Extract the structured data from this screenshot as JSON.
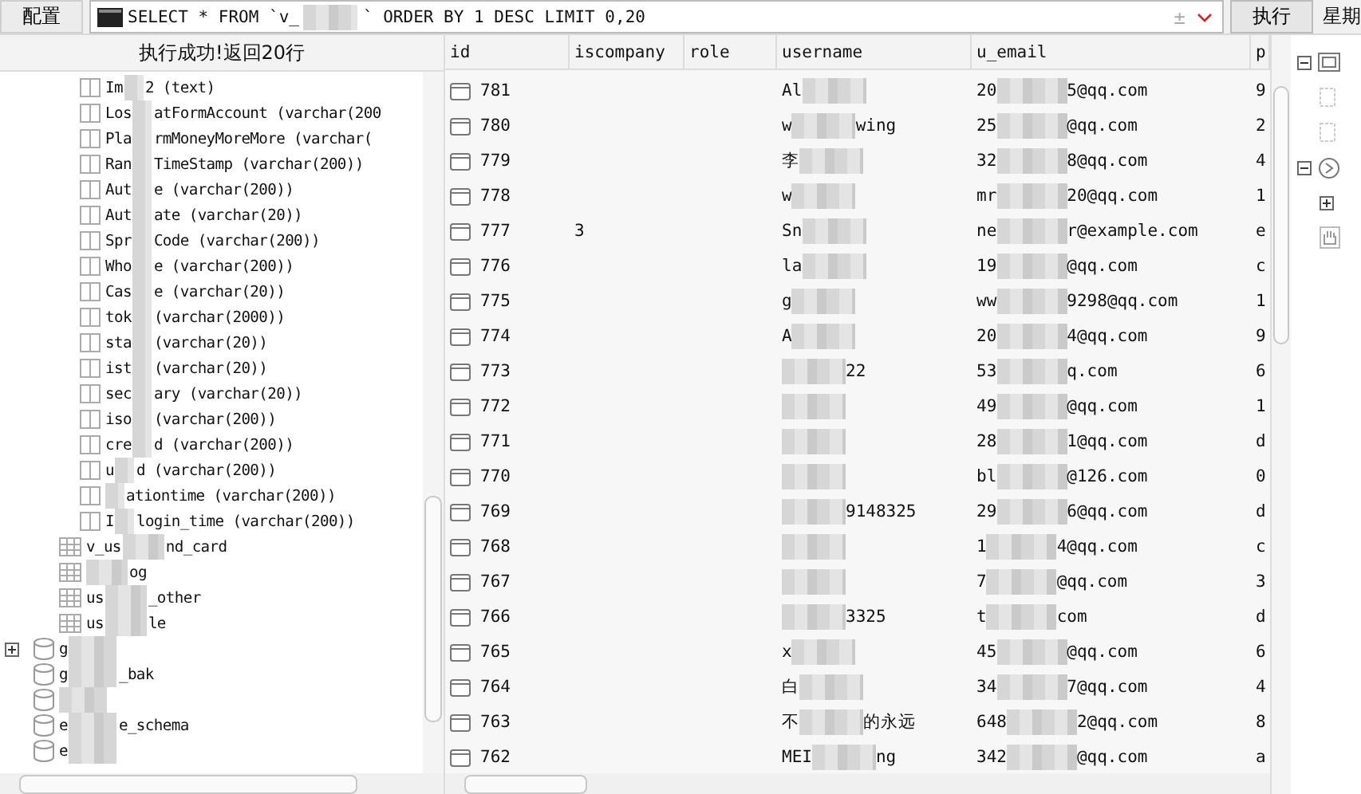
{
  "toolbar": {
    "config_button": "配置",
    "query": {
      "pre": "SELECT * FROM `v_",
      "post": "` ORDER BY 1 DESC LIMIT 0,20"
    },
    "plusminus": "±",
    "run_button": "执行",
    "cut_label": "星期"
  },
  "status": "执行成功!返回20行",
  "tree": {
    "columns": [
      {
        "pre": "Im",
        "post": "2 (text)"
      },
      {
        "pre": "Los",
        "post": "atFormAccount (varchar(200"
      },
      {
        "pre": "Pla",
        "post": "rmMoneyMoreMore (varchar("
      },
      {
        "pre": "Ran",
        "post": "TimeStamp (varchar(200))"
      },
      {
        "pre": "Aut",
        "post": "e (varchar(200))"
      },
      {
        "pre": "Aut",
        "post": "ate (varchar(20))"
      },
      {
        "pre": "Spr",
        "post": "Code (varchar(200))"
      },
      {
        "pre": "Who",
        "post": "e (varchar(200))"
      },
      {
        "pre": "Cas",
        "post": "e (varchar(20))"
      },
      {
        "pre": "tok",
        "post": "(varchar(2000))"
      },
      {
        "pre": "sta",
        "post": "(varchar(20))"
      },
      {
        "pre": "ist",
        "post": "(varchar(20))"
      },
      {
        "pre": "sec",
        "post": "ary (varchar(20))"
      },
      {
        "pre": "iso",
        "post": "(varchar(200))"
      },
      {
        "pre": "cre",
        "post": "d (varchar(200))"
      },
      {
        "pre": "u",
        "post": "d (varchar(200))"
      },
      {
        "post": "ationtime (varchar(200))"
      },
      {
        "pre": "I",
        "post": "login_time (varchar(200))"
      }
    ],
    "tables": [
      {
        "pre": "v_us",
        "post": "nd_card"
      },
      {
        "post": "og"
      },
      {
        "pre": "us",
        "post": "_other"
      },
      {
        "pre": "us",
        "post": "le"
      }
    ],
    "databases": [
      {
        "pre": "g",
        "expandable": true
      },
      {
        "pre": "g",
        "post": "_bak",
        "expandable": false
      },
      {
        "expandable": false
      },
      {
        "pre": "e",
        "post": "e_schema",
        "expandable": false
      },
      {
        "pre": "e",
        "expandable": false
      }
    ]
  },
  "table": {
    "columns": [
      "id",
      "iscompany",
      "role",
      "username",
      "u_email",
      "p"
    ],
    "rows": [
      {
        "id": "781",
        "username": {
          "pre": "Al"
        },
        "email": {
          "pre": "20",
          "post": "5@qq.com"
        },
        "column_6": "9"
      },
      {
        "id": "780",
        "username": {
          "pre": "w",
          "post": "wing"
        },
        "email": {
          "pre": "25",
          "post": "@qq.com"
        },
        "column_6": "2"
      },
      {
        "id": "779",
        "username": {
          "pre": "李"
        },
        "email": {
          "pre": "32",
          "post": "8@qq.com"
        },
        "column_6": "4"
      },
      {
        "id": "778",
        "username": {
          "pre": "w"
        },
        "email": {
          "pre": "mr",
          "post": "20@qq.com"
        },
        "column_6": "1"
      },
      {
        "id": "777",
        "iscompany": "3",
        "username": {
          "pre": "Sn"
        },
        "email": {
          "pre": "ne",
          "post": "r@example.com"
        },
        "column_6": "e"
      },
      {
        "id": "776",
        "username": {
          "pre": "la"
        },
        "email": {
          "pre": "19",
          "post": "@qq.com"
        },
        "column_6": "c"
      },
      {
        "id": "775",
        "username": {
          "pre": "g"
        },
        "email": {
          "pre": "ww",
          "post": "9298@qq.com"
        },
        "column_6": "1"
      },
      {
        "id": "774",
        "username": {
          "pre": "A"
        },
        "email": {
          "pre": "20",
          "post": "4@qq.com"
        },
        "column_6": "9"
      },
      {
        "id": "773",
        "username": {
          "post": "22"
        },
        "email": {
          "pre": "53",
          "post": "q.com"
        },
        "column_6": "6"
      },
      {
        "id": "772",
        "username": {},
        "email": {
          "pre": "49",
          "post": "@qq.com"
        },
        "column_6": "1"
      },
      {
        "id": "771",
        "username": {},
        "email": {
          "pre": "28",
          "post": "1@qq.com"
        },
        "column_6": "d"
      },
      {
        "id": "770",
        "username": {},
        "email": {
          "pre": "bl",
          "post": "@126.com"
        },
        "column_6": "0"
      },
      {
        "id": "769",
        "username": {
          "post": "9148325"
        },
        "email": {
          "pre": "29",
          "post": "6@qq.com"
        },
        "column_6": "d"
      },
      {
        "id": "768",
        "username": {},
        "email": {
          "pre": "1",
          "post": "4@qq.com"
        },
        "column_6": "c"
      },
      {
        "id": "767",
        "username": {},
        "email": {
          "pre": "7",
          "post": "@qq.com"
        },
        "column_6": "3"
      },
      {
        "id": "766",
        "username": {
          "post": "3325"
        },
        "email": {
          "pre": "t",
          "post": "com"
        },
        "column_6": "d"
      },
      {
        "id": "765",
        "username": {
          "pre": "x"
        },
        "email": {
          "pre": "45",
          "post": "@qq.com"
        },
        "column_6": "6"
      },
      {
        "id": "764",
        "username": {
          "pre": "白"
        },
        "email": {
          "pre": "34",
          "post": "7@qq.com"
        },
        "column_6": "4"
      },
      {
        "id": "763",
        "username": {
          "pre": "不",
          "post": "的永远"
        },
        "email": {
          "pre": "648",
          "post": "2@qq.com"
        },
        "column_6": "8"
      },
      {
        "id": "762",
        "username": {
          "pre": "MEI",
          "post": "ng"
        },
        "email": {
          "pre": "342",
          "post": "@qq.com"
        },
        "column_6": "a"
      }
    ]
  }
}
